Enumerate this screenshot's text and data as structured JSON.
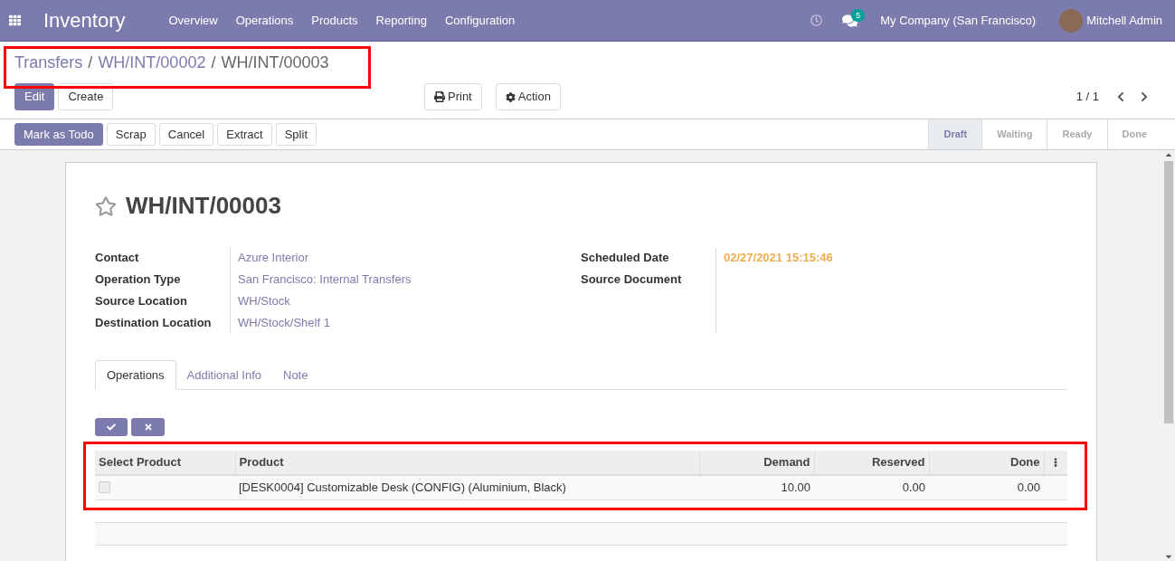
{
  "navbar": {
    "app": "Inventory",
    "menu": [
      "Overview",
      "Operations",
      "Products",
      "Reporting",
      "Configuration"
    ],
    "message_count": "5",
    "company": "My Company (San Francisco)",
    "user": "Mitchell Admin"
  },
  "breadcrumbs": [
    "Transfers",
    "WH/INT/00002",
    "WH/INT/00003"
  ],
  "breadcrumb_separator": "/",
  "buttons": [
    {
      "label": "Edit",
      "primary": true
    },
    {
      "label": "Create",
      "primary": false
    }
  ],
  "actions": [
    {
      "label": "Print",
      "kind": "print"
    },
    {
      "label": "Action",
      "kind": "gear"
    }
  ],
  "pager": "1 / 1",
  "workflow_buttons": [
    {
      "label": "Mark as Todo",
      "primary": true
    },
    {
      "label": "Scrap",
      "primary": false
    },
    {
      "label": "Cancel",
      "primary": false
    },
    {
      "label": "Extract",
      "primary": false
    },
    {
      "label": "Split",
      "primary": false
    }
  ],
  "stages": [
    {
      "label": "Draft",
      "selected": true
    },
    {
      "label": "Waiting",
      "selected": false
    },
    {
      "label": "Ready",
      "selected": false
    },
    {
      "label": "Done",
      "selected": false
    }
  ],
  "record": {
    "title": "WH/INT/00003",
    "starred": false,
    "left_fields": [
      {
        "label": "Contact",
        "value": "Azure Interior"
      },
      {
        "label": "Operation Type",
        "value": "San Francisco: Internal Transfers"
      },
      {
        "label": "Source Location",
        "value": "WH/Stock"
      },
      {
        "label": "Destination Location",
        "value": "WH/Stock/Shelf 1"
      }
    ],
    "right_fields": [
      {
        "label": "Scheduled Date",
        "value": "02/27/2021 15:15:46",
        "kind": "date"
      },
      {
        "label": "Source Document"
      }
    ]
  },
  "tabs": [
    {
      "label": "Operations",
      "selected": true
    },
    {
      "label": "Additional Info",
      "selected": false
    },
    {
      "label": "Note",
      "selected": false
    }
  ],
  "table": {
    "columns": [
      "Select Product",
      "Product",
      "Demand",
      "Reserved",
      "Done"
    ],
    "rows": [
      {
        "checked": false,
        "product": "[DESK0004] Customizable Desk (CONFIG) (Aluminium, Black)",
        "demand": "10.00",
        "reserved": "0.00",
        "done": "0.00"
      }
    ]
  }
}
